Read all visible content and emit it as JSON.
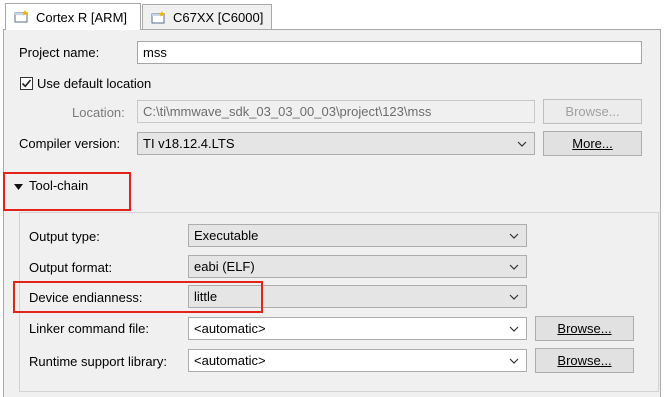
{
  "tabs": [
    {
      "label": "Cortex R [ARM]",
      "active": true
    },
    {
      "label": "C67XX [C6000]",
      "active": false
    }
  ],
  "project_name": {
    "label": "Project name:",
    "value": "mss"
  },
  "default_location": {
    "label": "Use default location",
    "checked": true
  },
  "location": {
    "label": "Location:",
    "value": "C:\\ti\\mmwave_sdk_03_03_00_03\\project\\123\\mss",
    "browse_label": "Browse..."
  },
  "compiler": {
    "label": "Compiler version:",
    "value": "TI v18.12.4.LTS",
    "more_label": "More..."
  },
  "toolchain": {
    "label": "Tool-chain"
  },
  "output_type": {
    "label": "Output type:",
    "value": "Executable"
  },
  "output_format": {
    "label": "Output format:",
    "value": "eabi (ELF)"
  },
  "endianness": {
    "label": "Device endianness:",
    "value": "little"
  },
  "linker_cmd": {
    "label": "Linker command file:",
    "value": "<automatic>",
    "browse_label": "Browse..."
  },
  "runtime_lib": {
    "label": "Runtime support library:",
    "value": "<automatic>",
    "browse_label": "Browse..."
  },
  "colors": {
    "highlight": "#e2231a",
    "panel": "#f0f0f0",
    "combo": "#e5e5e5"
  }
}
